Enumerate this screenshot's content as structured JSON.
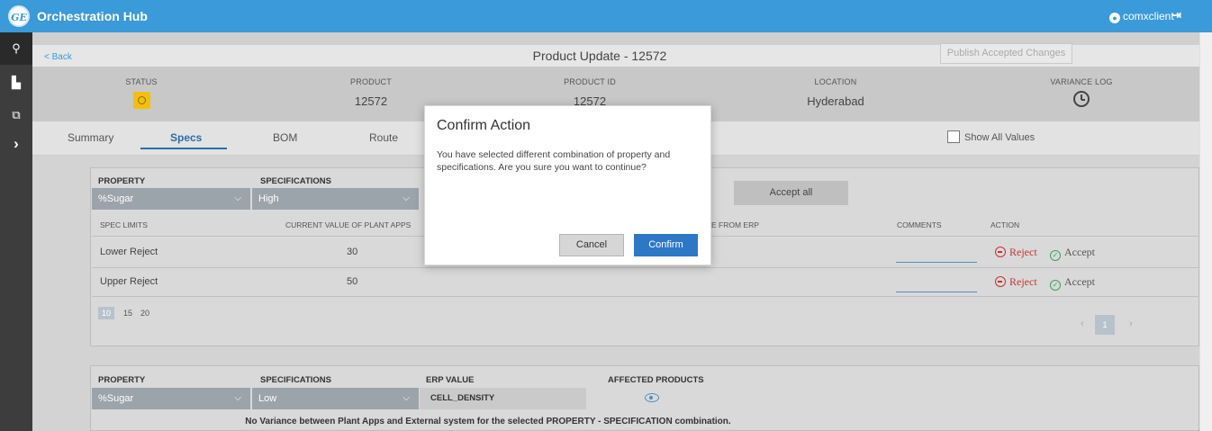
{
  "app": {
    "title": "Orchestration Hub",
    "logo": "GE",
    "user": "comxclient"
  },
  "colors": {
    "header": "#3b9ad9",
    "rail": "#3d3d3d",
    "accent": "#2d77c7",
    "reject": "#c83232",
    "accept": "#3aa35c",
    "status": "#f2c00a"
  },
  "rail": {
    "icons": [
      "hierarchy-icon",
      "factory-icon",
      "hub-icon",
      "chevron-right-icon"
    ]
  },
  "page": {
    "back": "< Back",
    "title": "Product Update - 12572",
    "publish": "Publish Accepted Changes"
  },
  "info": {
    "status_label": "STATUS",
    "product_label": "PRODUCT",
    "product": "12572",
    "product_id_label": "PRODUCT ID",
    "product_id": "12572",
    "location_label": "LOCATION",
    "location": "Hyderabad",
    "variance_label": "VARIANCE LOG"
  },
  "tabs": [
    {
      "label": "Summary"
    },
    {
      "label": "Specs"
    },
    {
      "label": "BOM"
    },
    {
      "label": "Route"
    }
  ],
  "show_all": "Show All Values",
  "panel1": {
    "property_label": "PROPERTY",
    "property": "%Sugar",
    "spec_label": "SPECIFICATIONS",
    "spec": "High",
    "accept_all": "Accept all",
    "headers": {
      "limits": "SPEC LIMITS",
      "current": "CURRENT VALUE OF PLANT APPS",
      "erp": "E FROM ERP",
      "comments": "COMMENTS",
      "action": "ACTION"
    },
    "rows": [
      {
        "limit": "Lower Reject",
        "current": "30"
      },
      {
        "limit": "Upper Reject",
        "current": "50"
      }
    ],
    "reject": "Reject",
    "accept": "Accept",
    "page_sizes": [
      "10",
      "15",
      "20"
    ],
    "page": "1"
  },
  "panel2": {
    "property_label": "PROPERTY",
    "property": "%Sugar",
    "spec_label": "SPECIFICATIONS",
    "spec": "Low",
    "erp_label": "ERP VALUE",
    "erp": "CELL_DENSITY",
    "affected_label": "AFFECTED PRODUCTS",
    "message": "No Variance between Plant Apps and External system for the selected PROPERTY - SPECIFICATION combination."
  },
  "modal": {
    "title": "Confirm Action",
    "body": "You have selected different combination of property and specifications. Are you sure you want to continue?",
    "cancel": "Cancel",
    "confirm": "Confirm"
  }
}
